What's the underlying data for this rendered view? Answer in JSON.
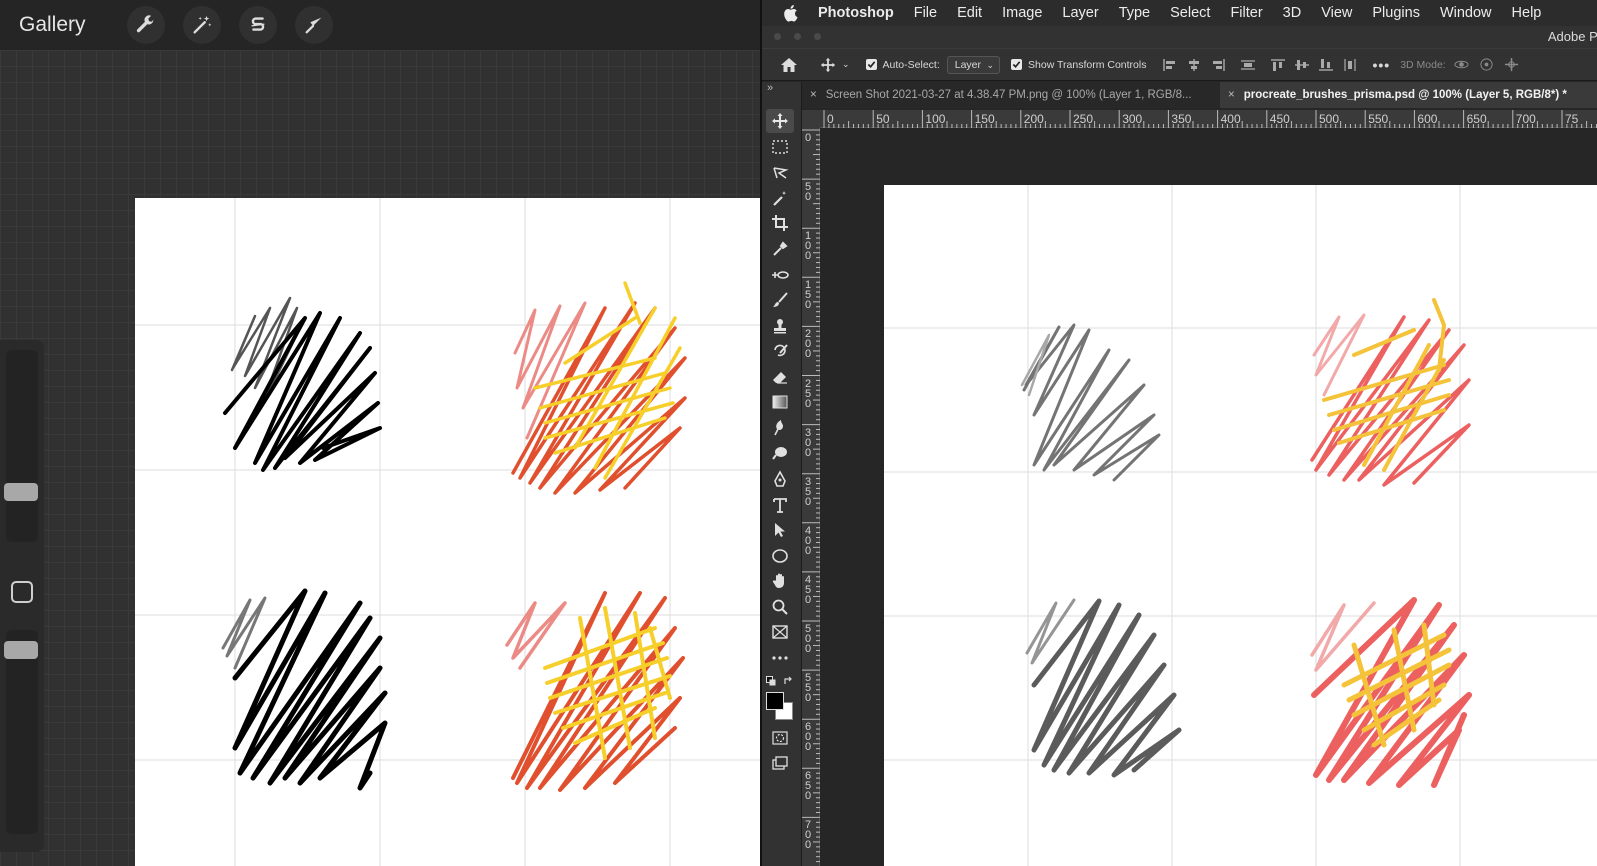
{
  "procreate": {
    "gallery_label": "Gallery",
    "tools": [
      "wrench-icon",
      "magic-wand-icon",
      "selection-s-icon",
      "transform-arrow-icon"
    ],
    "colors": {
      "black_stroke": "#000000",
      "red_stroke": "#e0502e",
      "yellow_stroke": "#f7cf2a",
      "pink_stroke": "#ec8a86"
    }
  },
  "photoshop": {
    "menu": [
      "Photoshop",
      "File",
      "Edit",
      "Image",
      "Layer",
      "Type",
      "Select",
      "Filter",
      "3D",
      "View",
      "Plugins",
      "Window",
      "Help"
    ],
    "app_title": "Adobe Ph",
    "options": {
      "auto_select_label": "Auto-Select:",
      "auto_select_value": "Layer",
      "show_transform_label": "Show Transform Controls",
      "mode_3d_label": "3D Mode:"
    },
    "tabs": [
      {
        "label": "Screen Shot 2021-03-27 at 4.38.47 PM.png @ 100% (Layer 1, RGB/8...",
        "active": false
      },
      {
        "label": "procreate_brushes_prisma.psd @ 100% (Layer 5, RGB/8*) *",
        "active": true
      }
    ],
    "ruler_h_labels": [
      "0",
      "50",
      "100",
      "150",
      "200",
      "250",
      "300",
      "350",
      "400",
      "450",
      "500",
      "550",
      "600",
      "650",
      "700",
      "75"
    ],
    "ruler_v_labels": [
      "0",
      "50",
      "100",
      "150",
      "200",
      "250",
      "300",
      "350",
      "400",
      "450",
      "500",
      "550",
      "600",
      "650",
      "700"
    ],
    "colors": {
      "gray_stroke": "#5c5c5c",
      "red_stroke": "#ea4f4f",
      "yellow_stroke": "#f3bd25",
      "pink_stroke": "#f1a0a0"
    }
  }
}
